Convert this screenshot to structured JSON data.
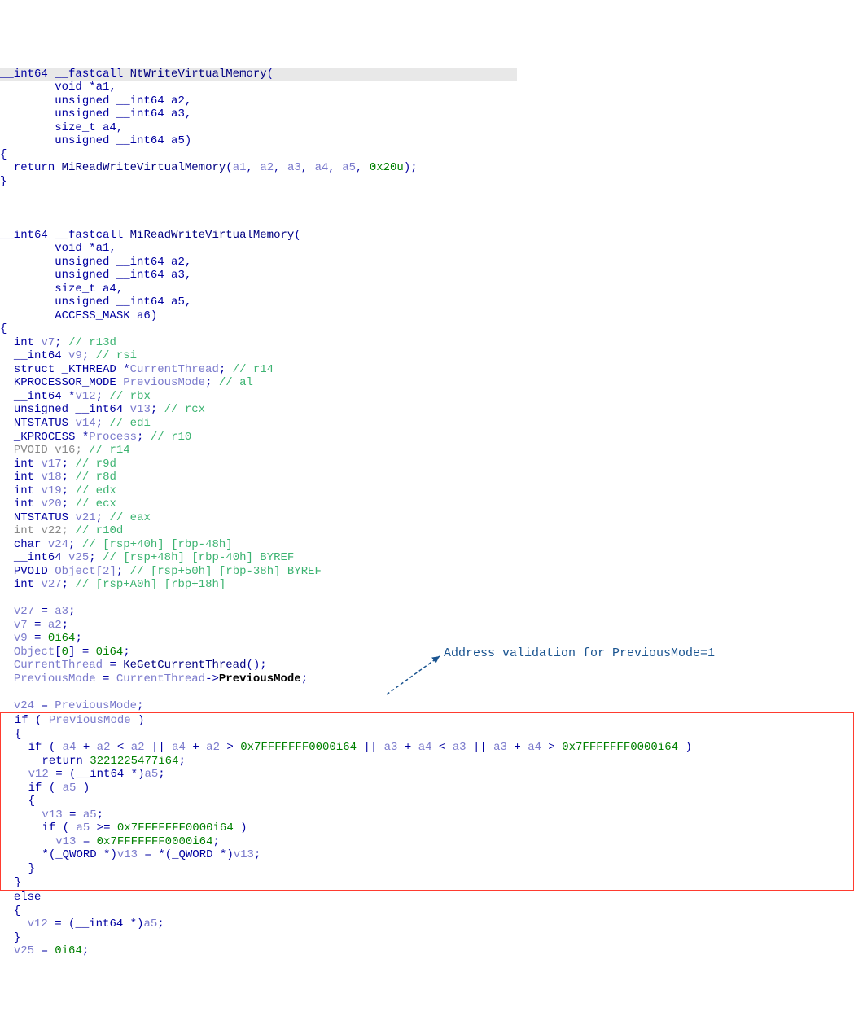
{
  "func1": {
    "sig_prefix": "__int64 __fastcall ",
    "name": "NtWriteVirtualMemory",
    "params": [
      "void *a1,",
      "unsigned __int64 a2,",
      "unsigned __int64 a3,",
      "size_t a4,",
      "unsigned __int64 a5)"
    ],
    "return_kw": "return",
    "call": "MiReadWriteVirtualMemory",
    "args_a1": "a1",
    "args_a2": "a2",
    "args_a3": "a3",
    "args_a4": "a4",
    "args_a5": "a5",
    "last_arg": "0x20u"
  },
  "func2": {
    "sig_prefix": "__int64 __fastcall ",
    "name": "MiReadWriteVirtualMemory",
    "params": [
      "void *a1,",
      "unsigned __int64 a2,",
      "unsigned __int64 a3,",
      "size_t a4,",
      "unsigned __int64 a5,",
      "ACCESS_MASK a6)"
    ],
    "decls": {
      "l1t": "int",
      "l1v": "v7",
      "l1c": "// r13d",
      "l2t": "__int64",
      "l2v": "v9",
      "l2c": "// rsi",
      "l3t": "struct _KTHREAD *",
      "l3v": "CurrentThread",
      "l3c": "// r14",
      "l4t": "KPROCESSOR_MODE",
      "l4v": "PreviousMode",
      "l4c": "// al",
      "l5t": "__int64 *",
      "l5v": "v12",
      "l5c": "// rbx",
      "l6t": "unsigned __int64",
      "l6v": "v13",
      "l6c": "// rcx",
      "l7t": "NTSTATUS",
      "l7v": "v14",
      "l7c": "// edi",
      "l8t": "_KPROCESS *",
      "l8v": "Process",
      "l8c": "// r10",
      "l9t": "PVOID",
      "l9v": "v16",
      "l9c": "// r14",
      "l10t": "int",
      "l10v": "v17",
      "l10c": "// r9d",
      "l11t": "int",
      "l11v": "v18",
      "l11c": "// r8d",
      "l12t": "int",
      "l12v": "v19",
      "l12c": "// edx",
      "l13t": "int",
      "l13v": "v20",
      "l13c": "// ecx",
      "l14t": "NTSTATUS",
      "l14v": "v21",
      "l14c": "// eax",
      "l15t": "int",
      "l15v": "v22",
      "l15c": "// r10d",
      "l16t": "char",
      "l16v": "v24",
      "l16c": "// [rsp+40h] [rbp-48h]",
      "l17t": "__int64",
      "l17v": "v25",
      "l17c": "// [rsp+48h] [rbp-40h] BYREF",
      "l18t": "PVOID",
      "l18v": "Object[2]",
      "l18c": "// [rsp+50h] [rbp-38h] BYREF",
      "l19t": "int",
      "l19v": "v27",
      "l19c": "// [rsp+A0h] [rbp+18h]"
    },
    "body": {
      "v27": "v27",
      "a3": "a3",
      "v7": "v7",
      "a2": "a2",
      "v9": "v9",
      "zero64": "0i64",
      "obj": "Object",
      "idx0": "0",
      "ct": "CurrentThread",
      "kefn": "KeGetCurrentThread",
      "pm": "PreviousMode",
      "pmfield": "PreviousMode",
      "v24": "v24"
    },
    "ifblock": {
      "if": "if",
      "pm": "PreviousMode",
      "a4": "a4",
      "a2": "a2",
      "a3": "a3",
      "big": "0x7FFFFFFF0000i64",
      "ret": "return",
      "retval": "3221225477i64",
      "v12": "v12",
      "int64cast": "__int64 *",
      "a5": "a5",
      "v13": "v13",
      "qwordcast": "_QWORD *"
    },
    "elseblock": {
      "else": "else",
      "v12": "v12",
      "int64cast": "__int64 *",
      "a5": "a5"
    },
    "tail": {
      "v25": "v25",
      "zero64": "0i64"
    }
  },
  "annotation": "Address validation for PreviousMode=1"
}
